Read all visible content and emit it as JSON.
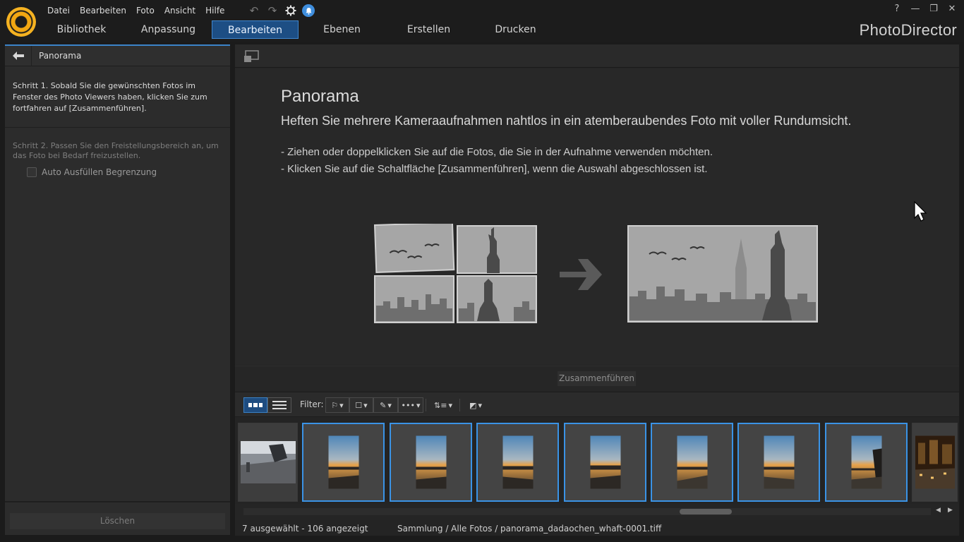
{
  "menu": [
    "Datei",
    "Bearbeiten",
    "Foto",
    "Ansicht",
    "Hilfe"
  ],
  "window_controls": [
    "?",
    "—",
    "❐",
    "✕"
  ],
  "app_name": "PhotoDirector",
  "tabs": [
    {
      "label": "Bibliothek",
      "active": false
    },
    {
      "label": "Anpassung",
      "active": false
    },
    {
      "label": "Bearbeiten",
      "active": true
    },
    {
      "label": "Ebenen",
      "active": false
    },
    {
      "label": "Erstellen",
      "active": false
    },
    {
      "label": "Drucken",
      "active": false
    }
  ],
  "left_panel": {
    "title": "Panorama",
    "step1": "Schritt 1. Sobald Sie die gewünschten Fotos im Fenster des Photo Viewers haben, klicken Sie zum fortfahren auf [Zusammenführen].",
    "step2": "Schritt 2. Passen Sie den Freistellungsbereich an, um das Foto bei Bedarf freizustellen.",
    "auto_fill_label": "Auto Ausfüllen Begrenzung",
    "auto_fill_checked": false,
    "delete_button": "Löschen"
  },
  "intro": {
    "title": "Panorama",
    "subtitle": "Heften Sie mehrere Kameraaufnahmen nahtlos in ein atemberaubendes Foto mit voller Rundumsicht.",
    "bullet1": "- Ziehen oder doppelklicken Sie auf die Fotos, die Sie in der Aufnahme verwenden möchten.",
    "bullet2": "- Klicken Sie auf die Schaltfläche [Zusammenführen], wenn die Auswahl abgeschlossen ist."
  },
  "merge_button": "Zusammenführen",
  "filter_bar": {
    "filter_label": "Filter:"
  },
  "filmstrip": {
    "thumbnails": [
      {
        "kind": "skate",
        "selected": false
      },
      {
        "kind": "sunset",
        "selected": true
      },
      {
        "kind": "sunset",
        "selected": true
      },
      {
        "kind": "sunset",
        "selected": true
      },
      {
        "kind": "sunset",
        "selected": true
      },
      {
        "kind": "sunset",
        "selected": true
      },
      {
        "kind": "sunset",
        "selected": true
      },
      {
        "kind": "sunset",
        "selected": true
      },
      {
        "kind": "city-night",
        "selected": false
      }
    ]
  },
  "status": {
    "count": "7 ausgewählt - 106 angezeigt",
    "path": "Sammlung / Alle Fotos / panorama_dadaochen_whaft-0001.tiff"
  },
  "colors": {
    "accent": "#3a93e6",
    "active_tab": "#1d4e84",
    "logo": "#f2a712"
  }
}
